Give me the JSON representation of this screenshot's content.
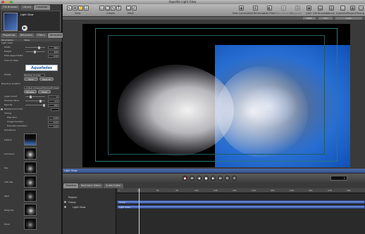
{
  "window": {
    "title": "Aqualite Light Glow"
  },
  "left_panel": {
    "top_tabs": [
      "File Browser",
      "Library",
      "Inspector"
    ],
    "preview_title": "Light Glow",
    "sub_tabs": [
      "Properties",
      "Behaviors",
      "Filters",
      "Generator"
    ],
    "sections": {
      "parameters": "Parameters",
      "value": "Value",
      "light_glow": "Light Glow"
    },
    "params": [
      {
        "label": "Width",
        "value": "960"
      },
      {
        "label": "Height",
        "value": "540"
      },
      {
        "label": "Pixel Aspect Ratio",
        "value": "1.00"
      }
    ],
    "click_for_help": "Click for Help",
    "logo_text": "Aquafadas",
    "preset_label": "Preset",
    "preset_value": "Multiple Overlap",
    "preset_buttons": [
      "Save",
      "Save As"
    ],
    "directory_label": "Directory location",
    "directory_value": "~/Library/Images/Photoswift Open Vids",
    "browse_buttons": [
      "Browse",
      "Clear"
    ],
    "more_params": [
      {
        "label": "Layer Count",
        "value": "6"
      },
      {
        "label": "Overlap Value",
        "value": "1.0"
      },
      {
        "label": "Opacity",
        "value": "100"
      }
    ],
    "background_color_label": "Background Color",
    "timing_section": "Timing",
    "timing_params": [
      {
        "label": "Play Mod",
        "value": "1.00"
      },
      {
        "label": "Image Duration",
        "value": "4.00"
      },
      {
        "label": "Transition Duration",
        "value": "1.00"
      }
    ],
    "transitions_section": "Transitions",
    "transitions": [
      "Lateral",
      "Cut Down",
      "Pop",
      "Left Cap",
      "Swirl",
      "Diagonal",
      "Diver"
    ]
  },
  "toolbar": {
    "buttons": [
      {
        "label": "View",
        "icon": "view-icon"
      },
      {
        "label": "Create",
        "icon": "create-icon"
      },
      {
        "label": "Mask",
        "icon": "mask-icon"
      },
      {
        "label": "New Camera",
        "icon": "camera-icon"
      },
      {
        "label": "Add Behavior",
        "icon": "behavior-icon"
      },
      {
        "label": "Add Filter",
        "icon": "filter-icon"
      },
      {
        "label": "Make Particles",
        "icon": "particles-icon"
      },
      {
        "label": "Replicate",
        "icon": "replicate-icon"
      },
      {
        "label": "HUD",
        "icon": "hud-icon"
      },
      {
        "label": "File Browser",
        "icon": "file-browser-icon"
      },
      {
        "label": "Library",
        "icon": "library-icon"
      },
      {
        "label": "Inspector",
        "icon": "inspector-icon"
      },
      {
        "label": "Project",
        "icon": "project-icon"
      },
      {
        "label": "Timing",
        "icon": "timing-icon"
      }
    ]
  },
  "canvas": {
    "zoom": "100%",
    "view": "Full",
    "color_mode": "Color"
  },
  "layer_bar_label": "Light Glow",
  "transport": {
    "current_frame": "1",
    "buttons": [
      "record",
      "go-start",
      "play-back",
      "stop",
      "play",
      "go-end",
      "loop",
      "audio"
    ]
  },
  "timeline": {
    "tabs": [
      "Timeline",
      "Keyframe Editor",
      "Audio Editor"
    ],
    "ruler_ticks": [
      "1",
      "26",
      "51",
      "76",
      "101",
      "126",
      "151",
      "176",
      "201",
      "226",
      "251",
      "276",
      "301"
    ],
    "rows": [
      {
        "name": "Project",
        "indent": false
      },
      {
        "name": "Group",
        "indent": false
      },
      {
        "name": "Light Glow",
        "indent": true
      }
    ],
    "bars": [
      "Group",
      "Light Glow"
    ]
  }
}
